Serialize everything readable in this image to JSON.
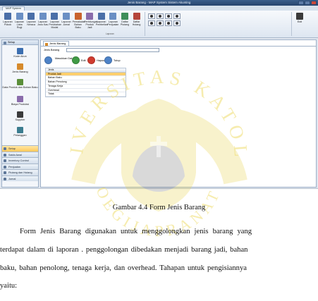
{
  "app": {
    "window_title": "Jenis Barang - MAP System Sistem Akunting",
    "ribbon_tab": "MAP System"
  },
  "ribbon": {
    "buttons": [
      {
        "label": "Laporan Pokok",
        "icon": "report-icon",
        "color": "#4b6fa8"
      },
      {
        "label": "Laporan Laba Rugi",
        "icon": "report-icon",
        "color": "#6a8fc4"
      },
      {
        "label": "Laporan Neraca",
        "icon": "report-icon",
        "color": "#4b6fa8"
      },
      {
        "label": "Laporan Arus Kas",
        "icon": "report-icon",
        "color": "#6a8fc4"
      },
      {
        "label": "Laporan Perubahan Modal",
        "icon": "report-icon",
        "color": "#4b6fa8"
      },
      {
        "label": "Laporan Jurnal",
        "icon": "report-icon",
        "color": "#6a8fc4"
      },
      {
        "label": "Pemakaian Bahan Baku",
        "icon": "material-icon",
        "color": "#c9632d"
      },
      {
        "label": "Perhitungan Produk Jadi",
        "icon": "product-icon",
        "color": "#8a6cab"
      },
      {
        "label": "Laporan Pembelian",
        "icon": "report-icon",
        "color": "#4b6fa8"
      },
      {
        "label": "Laporan Penjualan",
        "icon": "report-icon",
        "color": "#6a8fc4"
      },
      {
        "label": "Daftar Piutang",
        "icon": "list-icon",
        "color": "#3f8f5a"
      },
      {
        "label": "Daftar Hutang",
        "icon": "list-icon",
        "color": "#b5453b"
      }
    ],
    "group_label": "Laporan",
    "exit_label": "Exit",
    "exit_group": "Exit"
  },
  "sidebar": {
    "header": "Setup",
    "items": [
      {
        "label": "Kode Akun",
        "icon": "account-code-icon",
        "color": "#3c6fb0"
      },
      {
        "label": "Jenis Barang",
        "icon": "item-type-icon",
        "color": "#d68a2b"
      },
      {
        "label": "Data Produk dan Bahan Baku",
        "icon": "product-data-icon",
        "color": "#5b8f3a"
      },
      {
        "label": "Biaya Produksi",
        "icon": "production-cost-icon",
        "color": "#8a6cab"
      },
      {
        "label": "Supplier",
        "icon": "supplier-icon",
        "color": "#3b3b3b"
      },
      {
        "label": "Pelanggan",
        "icon": "customer-icon",
        "color": "#3b7d8f"
      }
    ],
    "nav": [
      {
        "label": "Setup",
        "active": true
      },
      {
        "label": "Saldo Awal",
        "active": false
      },
      {
        "label": "Inventory Control",
        "active": false
      },
      {
        "label": "Penjualan",
        "active": false
      },
      {
        "label": "Piutang dan Hutang",
        "active": false
      },
      {
        "label": "Jurnal",
        "active": false
      }
    ]
  },
  "main": {
    "tab": "Jenis Barang",
    "field_label": "Jenis Barang",
    "field_value": "",
    "toolbar": [
      {
        "label": "Masukkan Data",
        "color": "#4d82c7"
      },
      {
        "label": "Edit",
        "color": "#3f9a45"
      },
      {
        "label": "Hapus",
        "color": "#cf3b2f"
      },
      {
        "label": "Tutup",
        "color": "#4d82c7"
      }
    ],
    "grid_header": "Jenis",
    "grid_rows": [
      {
        "label": "Produk Jadi",
        "selected": true
      },
      {
        "label": "Bahan Baku",
        "selected": false
      },
      {
        "label": "Bahan Penolong",
        "selected": false
      },
      {
        "label": "Tenaga Kerja",
        "selected": false
      },
      {
        "label": "Overhead",
        "selected": false
      },
      {
        "label": "Tidak",
        "selected": false
      }
    ]
  },
  "watermark": {
    "top_text": "UNIVERSITAS KATOLIK",
    "bottom_text": "SOEGIJAPRANATA"
  },
  "document": {
    "caption": "Gambar 4.4 Form Jenis Barang",
    "lines": [
      "Form Jenis Barang digunakan untuk menggolongkan jenis barang yang",
      "terdapat dalam di laporan . penggolongan dibedakan menjadi barang jadi, bahan",
      "baku, bahan penolong, tenaga kerja, dan overhead. Tahapan untuk pengisiannya",
      "yaitu:"
    ]
  }
}
